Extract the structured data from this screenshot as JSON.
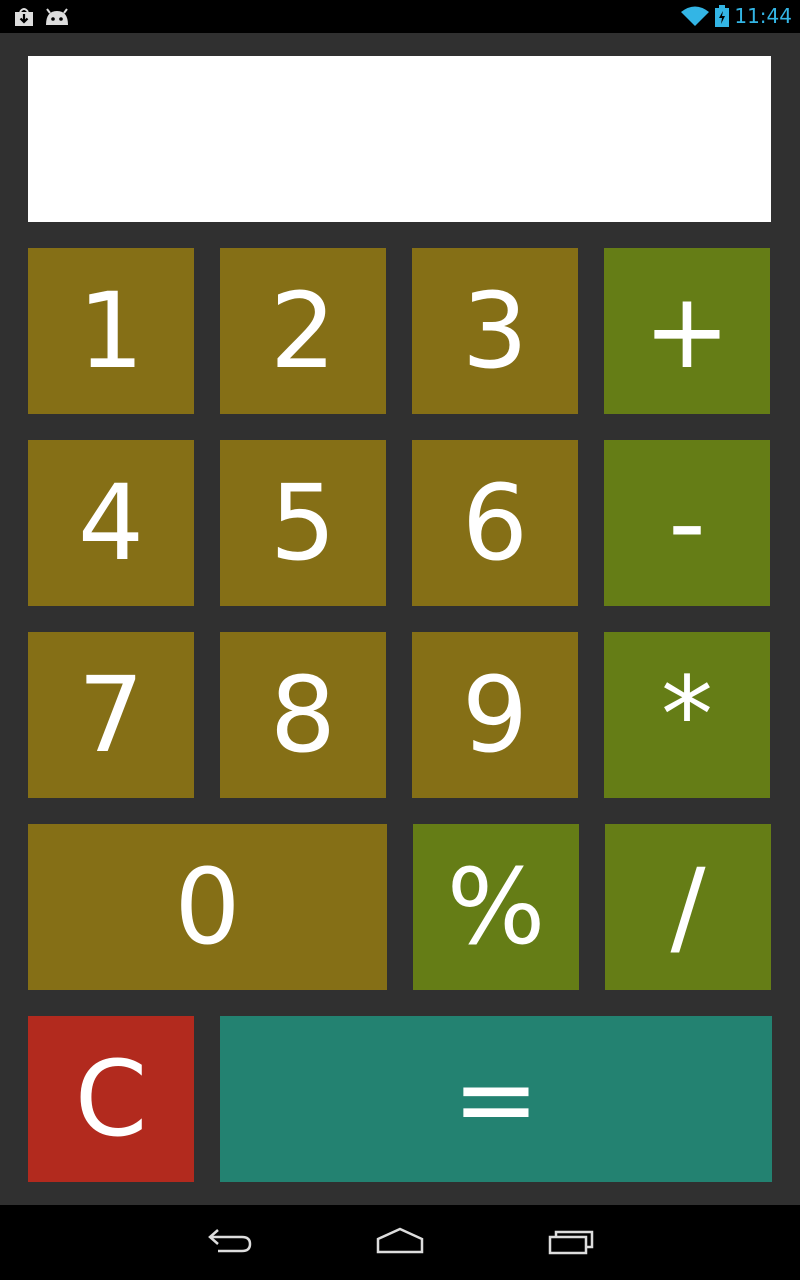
{
  "status_bar": {
    "time": "11:44",
    "left_icons": [
      "download-icon",
      "android-icon"
    ],
    "right_icons": [
      "wifi-icon",
      "battery-charging-icon"
    ]
  },
  "display": {
    "value": ""
  },
  "keys": {
    "k1": "1",
    "k2": "2",
    "k3": "3",
    "plus": "+",
    "k4": "4",
    "k5": "5",
    "k6": "6",
    "minus": "-",
    "k7": "7",
    "k8": "8",
    "k9": "9",
    "multiply": "*",
    "k0": "0",
    "percent": "%",
    "divide": "/",
    "clear": "C",
    "equals": "="
  },
  "colors": {
    "digit_key": "#856f16",
    "operator_key": "#657d16",
    "clear_key": "#b22a1e",
    "equals_key": "#238271",
    "background": "#303030",
    "status_accent": "#33b5e5"
  },
  "nav_bar": {
    "buttons": [
      "back-icon",
      "home-icon",
      "recent-apps-icon"
    ]
  }
}
